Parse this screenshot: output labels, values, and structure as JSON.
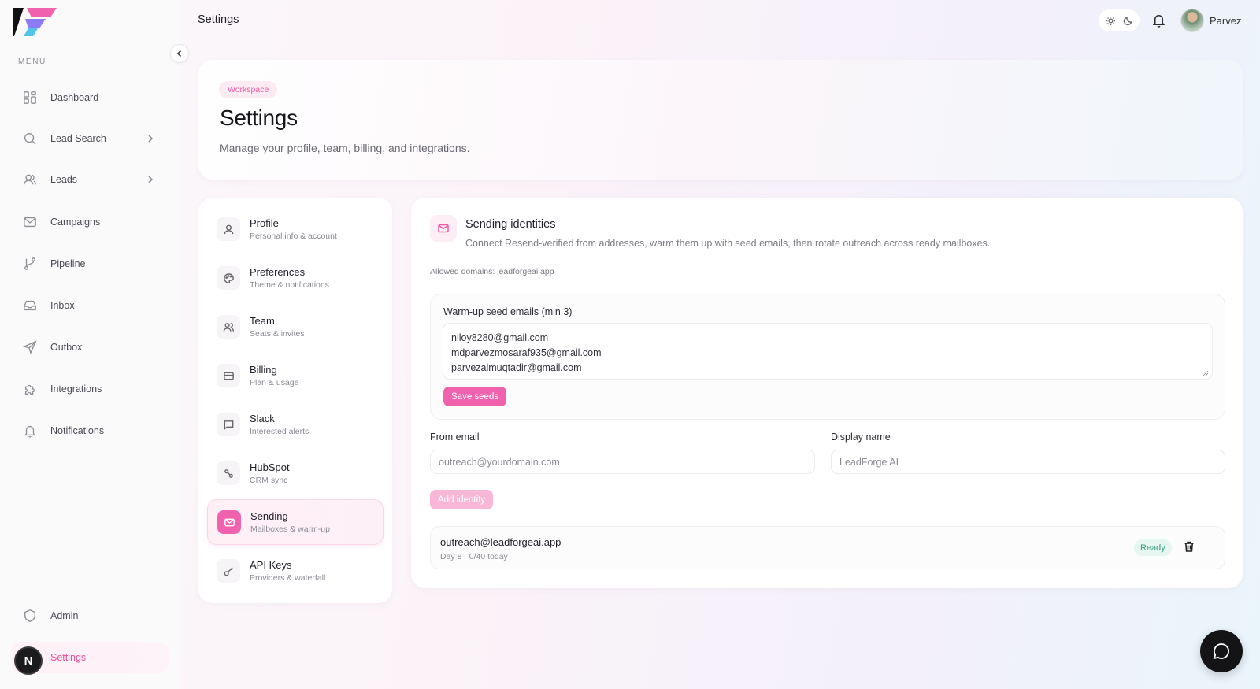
{
  "sidebar": {
    "menu_label": "MENU",
    "items": [
      {
        "label": "Dashboard",
        "icon": "dashboard-icon"
      },
      {
        "label": "Lead Search",
        "icon": "search-icon"
      },
      {
        "label": "Leads",
        "icon": "users-icon"
      },
      {
        "label": "Campaigns",
        "icon": "mail-icon"
      },
      {
        "label": "Pipeline",
        "icon": "pipeline-icon"
      },
      {
        "label": "Inbox",
        "icon": "inbox-icon"
      },
      {
        "label": "Outbox",
        "icon": "send-icon"
      },
      {
        "label": "Integrations",
        "icon": "puzzle-icon"
      },
      {
        "label": "Notifications",
        "icon": "bell-icon"
      }
    ],
    "admin_label": "Admin",
    "settings_label": "Settings",
    "avatar_letter": "N"
  },
  "topbar": {
    "title": "Settings",
    "user_name": "Parvez"
  },
  "header": {
    "badge": "Workspace",
    "title": "Settings",
    "subtitle": "Manage your profile, team, billing, and integrations."
  },
  "settings_nav": [
    {
      "title": "Profile",
      "sub": "Personal info & account"
    },
    {
      "title": "Preferences",
      "sub": "Theme & notifications"
    },
    {
      "title": "Team",
      "sub": "Seats & invites"
    },
    {
      "title": "Billing",
      "sub": "Plan & usage"
    },
    {
      "title": "Slack",
      "sub": "Interested alerts"
    },
    {
      "title": "HubSpot",
      "sub": "CRM sync"
    },
    {
      "title": "Sending",
      "sub": "Mailboxes & warm-up"
    },
    {
      "title": "API Keys",
      "sub": "Providers & waterfall"
    }
  ],
  "panel": {
    "title": "Sending identities",
    "description": "Connect Resend-verified from addresses, warm them up with seed emails, then rotate outreach across ready mailboxes.",
    "allowed_domains": "Allowed domains: leadforgeai.app",
    "seed_label": "Warm-up seed emails (min 3)",
    "seed_emails": "niloy8280@gmail.com\nmdparvezmosaraf935@gmail.com\nparvezalmuqtadir@gmail.com",
    "save_seeds": "Save seeds",
    "from_email_label": "From email",
    "from_email_placeholder": "outreach@yourdomain.com",
    "display_name_label": "Display name",
    "display_name_placeholder": "LeadForge AI",
    "add_identity": "Add identity",
    "identity": {
      "email": "outreach@leadforgeai.app",
      "meta": "Day 8 · 0/40 today",
      "status": "Ready"
    }
  },
  "colors": {
    "accent": "#f062ae",
    "ready_bg": "#e6f6f1",
    "ready_text": "#3b9c7f"
  }
}
